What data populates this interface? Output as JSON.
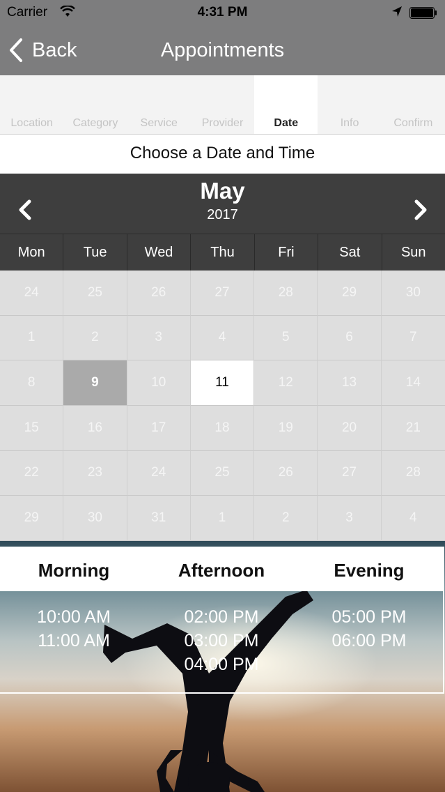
{
  "status": {
    "carrier": "Carrier",
    "time": "4:31 PM"
  },
  "nav": {
    "back_label": "Back",
    "title": "Appointments"
  },
  "steps": [
    "Location",
    "Category",
    "Service",
    "Provider",
    "Date",
    "Info",
    "Confirm"
  ],
  "active_step": "Date",
  "heading": "Choose a Date and Time",
  "calendar": {
    "month": "May",
    "year": "2017",
    "weekdays": [
      "Mon",
      "Tue",
      "Wed",
      "Thu",
      "Fri",
      "Sat",
      "Sun"
    ],
    "days": [
      "24",
      "25",
      "26",
      "27",
      "28",
      "29",
      "30",
      "1",
      "2",
      "3",
      "4",
      "5",
      "6",
      "7",
      "8",
      "9",
      "10",
      "11",
      "12",
      "13",
      "14",
      "15",
      "16",
      "17",
      "18",
      "19",
      "20",
      "21",
      "22",
      "23",
      "24",
      "25",
      "26",
      "27",
      "28",
      "29",
      "30",
      "31",
      "1",
      "2",
      "3",
      "4"
    ],
    "selected_day": "9",
    "today_day": "11"
  },
  "times": {
    "columns": [
      "Morning",
      "Afternoon",
      "Evening"
    ],
    "morning": [
      "10:00 AM",
      "11:00 AM"
    ],
    "afternoon": [
      "02:00 PM",
      "03:00 PM",
      "04:00 PM"
    ],
    "evening": [
      "05:00 PM",
      "06:00 PM"
    ]
  },
  "colors": {
    "bar": "#7d7d7e",
    "calendar_header": "#3e3e3e",
    "selected": "#aaaaaa"
  }
}
